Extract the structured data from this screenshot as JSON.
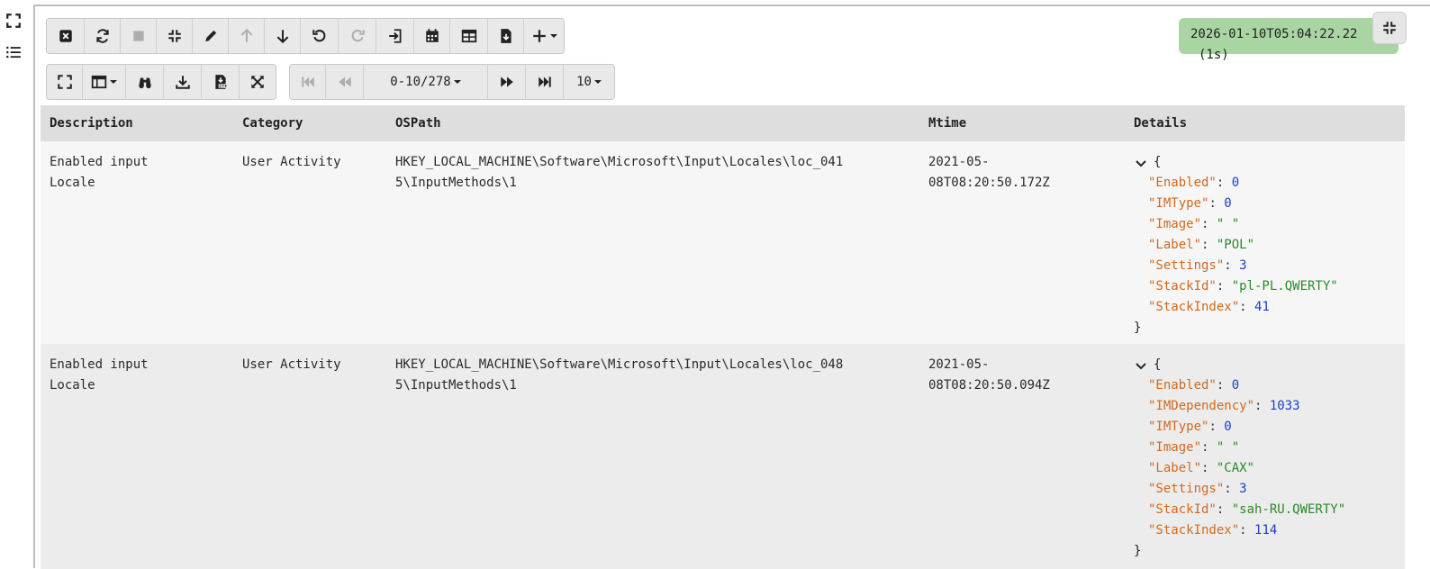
{
  "status": {
    "timestamp": "2026-01-10T05:04:22.22",
    "elapsed": "(1s)"
  },
  "pager": {
    "range": "0-10/278",
    "page_size": "10"
  },
  "columns": [
    "Description",
    "Category",
    "OSPath",
    "Mtime",
    "Details"
  ],
  "rows": [
    {
      "desc1": "Enabled input",
      "desc2": "Locale",
      "category": "User Activity",
      "path1": "HKEY_LOCAL_MACHINE\\Software\\Microsoft\\Input\\Locales\\loc_041",
      "path2": "5\\InputMethods\\1",
      "mtime1": "2021-05-",
      "mtime2": "08T08:20:50.172Z",
      "details": [
        {
          "k": "\"Enabled\"",
          "v": "0",
          "t": "n"
        },
        {
          "k": "\"IMType\"",
          "v": "0",
          "t": "n"
        },
        {
          "k": "\"Image\"",
          "v": "\" \"",
          "t": "s"
        },
        {
          "k": "\"Label\"",
          "v": "\"POL\"",
          "t": "s"
        },
        {
          "k": "\"Settings\"",
          "v": "3",
          "t": "n"
        },
        {
          "k": "\"StackId\"",
          "v": "\"pl-PL.QWERTY\"",
          "t": "s"
        },
        {
          "k": "\"StackIndex\"",
          "v": "41",
          "t": "n"
        }
      ]
    },
    {
      "desc1": "Enabled input",
      "desc2": "Locale",
      "category": "User Activity",
      "path1": "HKEY_LOCAL_MACHINE\\Software\\Microsoft\\Input\\Locales\\loc_048",
      "path2": "5\\InputMethods\\1",
      "mtime1": "2021-05-",
      "mtime2": "08T08:20:50.094Z",
      "details": [
        {
          "k": "\"Enabled\"",
          "v": "0",
          "t": "n"
        },
        {
          "k": "\"IMDependency\"",
          "v": "1033",
          "t": "n"
        },
        {
          "k": "\"IMType\"",
          "v": "0",
          "t": "n"
        },
        {
          "k": "\"Image\"",
          "v": "\" \"",
          "t": "s"
        },
        {
          "k": "\"Label\"",
          "v": "\"CAX\"",
          "t": "s"
        },
        {
          "k": "\"Settings\"",
          "v": "3",
          "t": "n"
        },
        {
          "k": "\"StackId\"",
          "v": "\"sah-RU.QWERTY\"",
          "t": "s"
        },
        {
          "k": "\"StackIndex\"",
          "v": "114",
          "t": "n"
        }
      ]
    }
  ],
  "json_syntax": {
    "open": "{",
    "close": "}",
    "sep": ": "
  },
  "icons": {
    "toolbar1": [
      "close-icon",
      "refresh-icon",
      "stop-icon",
      "compress-icon",
      "pencil-icon",
      "arrow-up-icon",
      "arrow-down-icon",
      "undo-icon",
      "redo-icon",
      "import-icon",
      "calendar-icon",
      "table-icon",
      "file-download-icon",
      "plus-icon"
    ],
    "toolbar2": [
      "expand-icon",
      "columns-icon",
      "binoculars-icon",
      "download-icon",
      "csv-file-icon",
      "fullscreen-icon"
    ],
    "pager": [
      "first-page-icon",
      "prev-page-icon",
      "next-page-icon",
      "last-page-icon"
    ]
  }
}
